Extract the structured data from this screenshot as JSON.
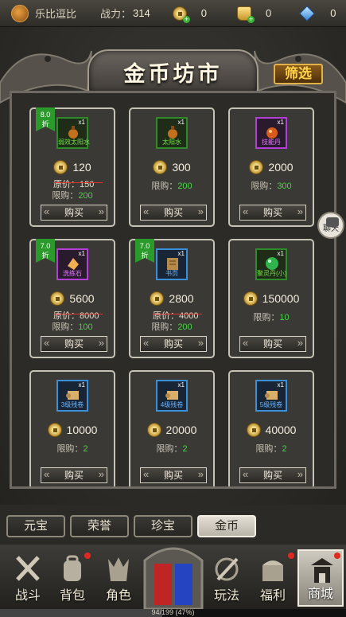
{
  "topbar": {
    "player_name": "乐比逗比",
    "power_label": "战力：",
    "power_value": "314",
    "resources": [
      {
        "icon": "gold-coin-icon",
        "value": "0"
      },
      {
        "icon": "gold-ingot-icon",
        "value": "0"
      },
      {
        "icon": "diamond-icon",
        "value": "0"
      }
    ]
  },
  "shop": {
    "title": "金币坊市",
    "filter_label": "筛选",
    "items": [
      {
        "name": "弱效太阳水",
        "qty": "x1",
        "rarity": "green",
        "discount_value": "8.0",
        "discount_unit": "折",
        "price": "120",
        "original_label": "原价：",
        "original_price": "150",
        "limit_label": "限购：",
        "limit": "200",
        "buy_label": "购买",
        "icon": "potion-icon"
      },
      {
        "name": "太阳水",
        "qty": "x1",
        "rarity": "green",
        "discount_value": "",
        "discount_unit": "",
        "price": "300",
        "original_label": "",
        "original_price": "",
        "limit_label": "限购：",
        "limit": "200",
        "buy_label": "购买",
        "icon": "potion-icon"
      },
      {
        "name": "技能丹",
        "qty": "x1",
        "rarity": "purple",
        "discount_value": "",
        "discount_unit": "",
        "price": "2000",
        "original_label": "",
        "original_price": "",
        "limit_label": "限购：",
        "limit": "300",
        "buy_label": "购买",
        "icon": "pill-icon"
      },
      {
        "name": "洗练石",
        "qty": "x1",
        "rarity": "purple",
        "discount_value": "7.0",
        "discount_unit": "折",
        "price": "5600",
        "original_label": "原价：",
        "original_price": "8000",
        "limit_label": "限购：",
        "limit": "100",
        "buy_label": "购买",
        "icon": "stone-icon"
      },
      {
        "name": "书页",
        "qty": "x1",
        "rarity": "blue",
        "discount_value": "7.0",
        "discount_unit": "折",
        "price": "2800",
        "original_label": "原价：",
        "original_price": "4000",
        "limit_label": "限购：",
        "limit": "200",
        "buy_label": "购买",
        "icon": "book-icon"
      },
      {
        "name": "聚灵丹(小)",
        "qty": "x1",
        "rarity": "green",
        "discount_value": "",
        "discount_unit": "",
        "price": "150000",
        "original_label": "",
        "original_price": "",
        "limit_label": "限购：",
        "limit": "10",
        "buy_label": "购买",
        "icon": "orb-icon"
      },
      {
        "name": "3级残卷",
        "qty": "x1",
        "rarity": "blue",
        "discount_value": "",
        "discount_unit": "",
        "price": "10000",
        "original_label": "",
        "original_price": "",
        "limit_label": "限购：",
        "limit": "2",
        "buy_label": "购买",
        "icon": "scroll-icon"
      },
      {
        "name": "4级残卷",
        "qty": "x1",
        "rarity": "blue",
        "discount_value": "",
        "discount_unit": "",
        "price": "20000",
        "original_label": "",
        "original_price": "",
        "limit_label": "限购：",
        "limit": "2",
        "buy_label": "购买",
        "icon": "scroll-icon"
      },
      {
        "name": "5级残卷",
        "qty": "x1",
        "rarity": "blue",
        "discount_value": "",
        "discount_unit": "",
        "price": "40000",
        "original_label": "",
        "original_price": "",
        "limit_label": "限购：",
        "limit": "2",
        "buy_label": "购买",
        "icon": "scroll-icon"
      }
    ]
  },
  "chat": {
    "label": "聊天"
  },
  "tabs": [
    {
      "label": "元宝",
      "active": false
    },
    {
      "label": "荣誉",
      "active": false
    },
    {
      "label": "珍宝",
      "active": false
    },
    {
      "label": "金币",
      "active": true
    }
  ],
  "nav": [
    {
      "label": "战斗",
      "icon": "crossed-swords-icon",
      "badge": false,
      "active": false
    },
    {
      "label": "背包",
      "icon": "backpack-icon",
      "badge": true,
      "active": false
    },
    {
      "label": "角色",
      "icon": "helmet-icon",
      "badge": false,
      "active": false
    },
    {
      "label": "玩法",
      "icon": "sword-ring-icon",
      "badge": false,
      "active": false
    },
    {
      "label": "福利",
      "icon": "treasure-chest-icon",
      "badge": true,
      "active": false
    },
    {
      "label": "商城",
      "icon": "shop-icon",
      "badge": true,
      "active": true
    }
  ],
  "exp": {
    "text": "94/199 (47%)",
    "progress": 0.47
  }
}
